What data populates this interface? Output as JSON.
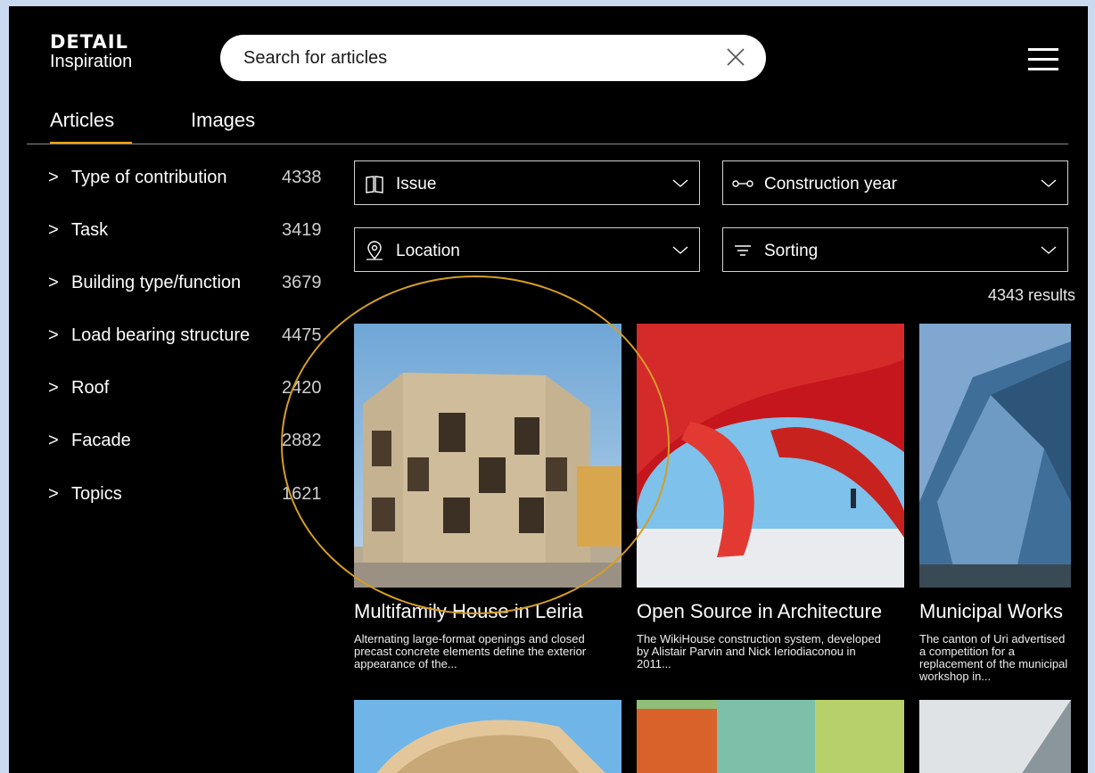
{
  "header": {
    "brand": "DETAIL",
    "brand_sub": "Inspiration",
    "search_placeholder": "Search for articles",
    "menu_icon": "hamburger-menu-icon"
  },
  "tabs": [
    {
      "label": "Articles",
      "active": true
    },
    {
      "label": "Images",
      "active": false
    }
  ],
  "facets": [
    {
      "label": "Type of contribution",
      "count": "4338"
    },
    {
      "label": "Task",
      "count": "3419"
    },
    {
      "label": "Building type/function",
      "count": "3679"
    },
    {
      "label": "Load bearing structure",
      "count": "4475"
    },
    {
      "label": "Roof",
      "count": "2420"
    },
    {
      "label": "Facade",
      "count": "2882"
    },
    {
      "label": "Topics",
      "count": "1621"
    }
  ],
  "filters": {
    "issue": {
      "label": "Issue",
      "icon": "open-book-icon"
    },
    "construction_year": {
      "label": "Construction year",
      "icon": "range-slider-icon"
    },
    "location": {
      "label": "Location",
      "icon": "location-pin-icon"
    },
    "sorting": {
      "label": "Sorting",
      "icon": "sort-lines-icon"
    }
  },
  "results_count": "4343 results",
  "articles": [
    {
      "title": "Multifamily House in Leiria",
      "desc": "Alternating large-format openings and closed precast concrete elements define the exterior appearance of the..."
    },
    {
      "title": "Open Source in Architecture",
      "desc": "The WikiHouse construction system, developed by Alistair Parvin and Nick Ieriodiaconou in 2011..."
    },
    {
      "title": "Municipal Works",
      "desc": "The canton of Uri advertised a competition for a replacement of the municipal workshop in..."
    }
  ],
  "colors": {
    "accent": "#e8a01c",
    "annotation_circle": "#d49d26",
    "background": "#000000"
  }
}
